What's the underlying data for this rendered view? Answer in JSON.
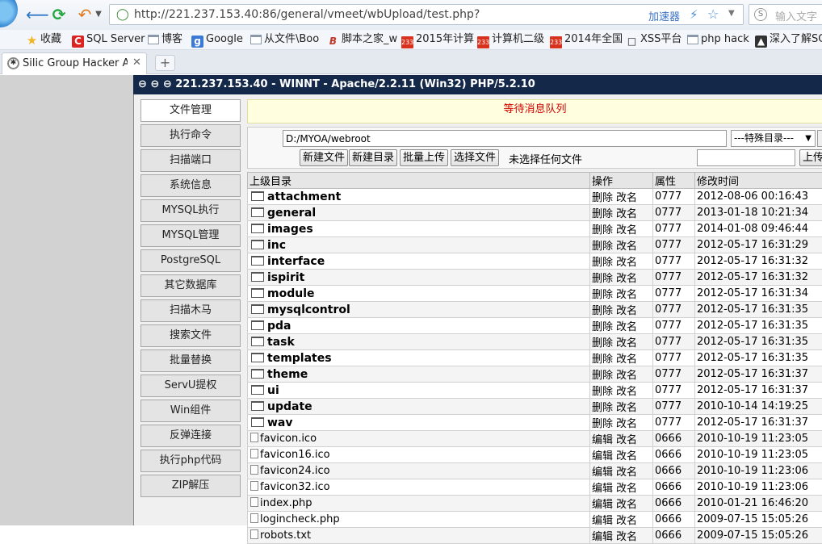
{
  "browser": {
    "url": "http://221.237.153.40:86/general/vmeet/wbUpload/test.php?",
    "accelerator_label": "加速器",
    "search_placeholder": "输入文字",
    "bookmarks": [
      "收藏",
      "SQL Server",
      "博客",
      "Google",
      "从文件\\Boo",
      "脚本之家_w",
      "2015年计算",
      "计算机二级",
      "2014年全国",
      "XSS平台",
      "php hack",
      "深入了解SQ"
    ],
    "tab_title": "Silic Group Hacker Army"
  },
  "header": {
    "title": "⊖ ⊖ ⊖ 221.237.153.40 - WINNT - Apache/2.2.11 (Win32) PHP/5.2.10"
  },
  "menu": [
    "文件管理",
    "执行命令",
    "扫描端口",
    "系统信息",
    "MYSQL执行",
    "MYSQL管理",
    "PostgreSQL",
    "其它数据库",
    "扫描木马",
    "搜索文件",
    "批量替换",
    "ServU提权",
    "Win组件",
    "反弹连接",
    "执行php代码",
    "ZIP解压"
  ],
  "message": "等待消息队列",
  "toolbar": {
    "path": "D:/MYOA/webroot",
    "special_dir": "---特殊目录---",
    "new_file": "新建文件",
    "new_dir": "新建目录",
    "batch_upload": "批量上传",
    "choose_file": "选择文件",
    "no_file": "未选择任何文件",
    "upload": "上传"
  },
  "table": {
    "headers": [
      "上级目录",
      "操作",
      "属性",
      "修改时间"
    ],
    "dirs": [
      {
        "name": "attachment",
        "op1": "删除",
        "op2": "改名",
        "attr": "0777",
        "time": "2012-08-06 00:16:43"
      },
      {
        "name": "general",
        "op1": "删除",
        "op2": "改名",
        "attr": "0777",
        "time": "2013-01-18 10:21:34"
      },
      {
        "name": "images",
        "op1": "删除",
        "op2": "改名",
        "attr": "0777",
        "time": "2014-01-08 09:46:44"
      },
      {
        "name": "inc",
        "op1": "删除",
        "op2": "改名",
        "attr": "0777",
        "time": "2012-05-17 16:31:29"
      },
      {
        "name": "interface",
        "op1": "删除",
        "op2": "改名",
        "attr": "0777",
        "time": "2012-05-17 16:31:32"
      },
      {
        "name": "ispirit",
        "op1": "删除",
        "op2": "改名",
        "attr": "0777",
        "time": "2012-05-17 16:31:32"
      },
      {
        "name": "module",
        "op1": "删除",
        "op2": "改名",
        "attr": "0777",
        "time": "2012-05-17 16:31:34"
      },
      {
        "name": "mysqlcontrol",
        "op1": "删除",
        "op2": "改名",
        "attr": "0777",
        "time": "2012-05-17 16:31:35"
      },
      {
        "name": "pda",
        "op1": "删除",
        "op2": "改名",
        "attr": "0777",
        "time": "2012-05-17 16:31:35"
      },
      {
        "name": "task",
        "op1": "删除",
        "op2": "改名",
        "attr": "0777",
        "time": "2012-05-17 16:31:35"
      },
      {
        "name": "templates",
        "op1": "删除",
        "op2": "改名",
        "attr": "0777",
        "time": "2012-05-17 16:31:35"
      },
      {
        "name": "theme",
        "op1": "删除",
        "op2": "改名",
        "attr": "0777",
        "time": "2012-05-17 16:31:37"
      },
      {
        "name": "ui",
        "op1": "删除",
        "op2": "改名",
        "attr": "0777",
        "time": "2012-05-17 16:31:37"
      },
      {
        "name": "update",
        "op1": "删除",
        "op2": "改名",
        "attr": "0777",
        "time": "2010-10-14 14:19:25"
      },
      {
        "name": "wav",
        "op1": "删除",
        "op2": "改名",
        "attr": "0777",
        "time": "2012-05-17 16:31:37"
      }
    ],
    "files": [
      {
        "name": "favicon.ico",
        "op1": "编辑",
        "op2": "改名",
        "attr": "0666",
        "time": "2010-10-19 11:23:05"
      },
      {
        "name": "favicon16.ico",
        "op1": "编辑",
        "op2": "改名",
        "attr": "0666",
        "time": "2010-10-19 11:23:05"
      },
      {
        "name": "favicon24.ico",
        "op1": "编辑",
        "op2": "改名",
        "attr": "0666",
        "time": "2010-10-19 11:23:06"
      },
      {
        "name": "favicon32.ico",
        "op1": "编辑",
        "op2": "改名",
        "attr": "0666",
        "time": "2010-10-19 11:23:06"
      },
      {
        "name": "index.php",
        "op1": "编辑",
        "op2": "改名",
        "attr": "0666",
        "time": "2010-01-21 16:46:20"
      },
      {
        "name": "logincheck.php",
        "op1": "编辑",
        "op2": "改名",
        "attr": "0666",
        "time": "2009-07-15 15:05:26"
      },
      {
        "name": "robots.txt",
        "op1": "编辑",
        "op2": "改名",
        "attr": "0666",
        "time": "2009-07-15 15:05:26"
      }
    ]
  }
}
